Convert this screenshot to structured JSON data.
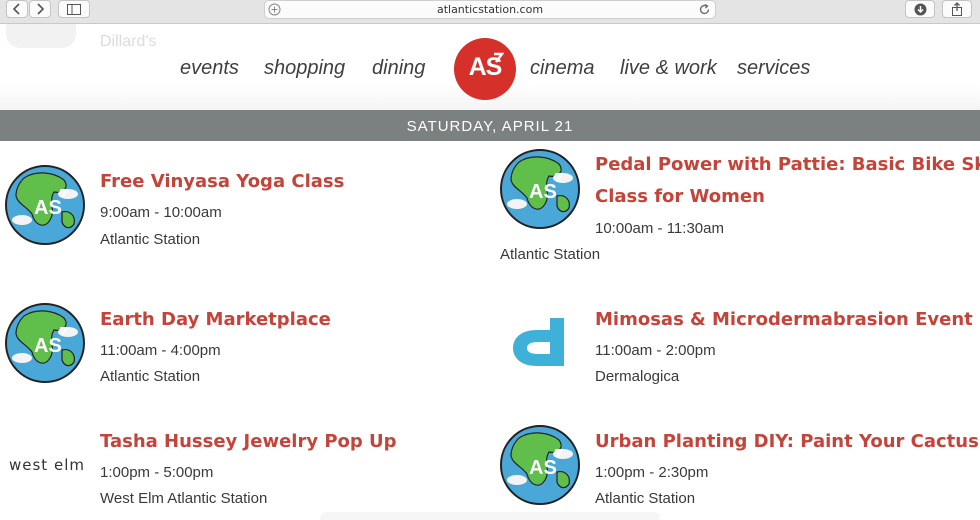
{
  "browser": {
    "url": "atlanticstation.com",
    "icons": [
      "back-icon",
      "forward-icon",
      "sidebar-icon",
      "plus-icon",
      "reload-icon",
      "download-icon",
      "share-icon"
    ]
  },
  "header": {
    "ghost_text": "Dillard's",
    "nav_left": [
      "events",
      "shopping",
      "dining"
    ],
    "logo_text": "AS",
    "nav_right": [
      "cinema",
      "live & work",
      "services"
    ]
  },
  "date_label": "SATURDAY, APRIL 21",
  "events": [
    {
      "title": "Free Vinyasa Yoga Class",
      "time": "9:00am - 10:00am",
      "location": "Atlantic Station",
      "image": "atlantic-station-globe"
    },
    {
      "title_line1": "Pedal Power with Pattie: Basic Bike Skills",
      "title_line2": "Class for Women",
      "time": "10:00am - 11:30am",
      "location": "Atlantic Station",
      "image": "atlantic-station-globe"
    },
    {
      "title": "Earth Day Marketplace",
      "time": "11:00am - 4:00pm",
      "location": "Atlantic Station",
      "image": "atlantic-station-globe"
    },
    {
      "title": "Mimosas & Microdermabrasion Event",
      "time": "11:00am - 2:00pm",
      "location": "Dermalogica",
      "image": "dermalogica-d-logo",
      "logo_letter": "d"
    },
    {
      "title": "Tasha Hussey Jewelry Pop Up",
      "time": "1:00pm - 5:00pm",
      "location": "West Elm Atlantic Station",
      "image": "west-elm-logo",
      "logo_text": "west elm"
    },
    {
      "title": "Urban Planting DIY: Paint Your Cactus",
      "time": "1:00pm - 2:30pm",
      "location": "Atlantic Station",
      "image": "atlantic-station-globe"
    }
  ],
  "colors": {
    "brand_red": "#d6302a",
    "title_red": "#c4443a",
    "date_bar": "#7b8081",
    "dermalogica_blue": "#3fb1d8"
  }
}
